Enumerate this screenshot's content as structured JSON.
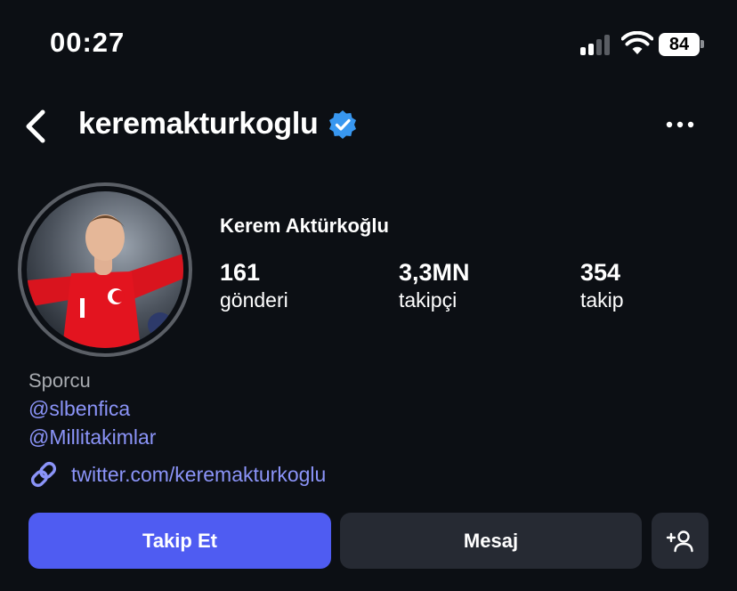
{
  "status_bar": {
    "time": "00:27",
    "battery": "84",
    "signal_bars_active": 2,
    "signal_bars_total": 4
  },
  "header": {
    "username": "keremakturkoglu",
    "back_icon": "chevron-left-icon",
    "verified_icon": "verified-badge-icon",
    "more_icon": "more-horizontal-icon"
  },
  "profile": {
    "display_name": "Kerem Aktürkoğlu",
    "stats": {
      "posts": {
        "count": "161",
        "label": "gönderi"
      },
      "followers": {
        "count": "3,3MN",
        "label": "takipçi"
      },
      "following": {
        "count": "354",
        "label": "takip"
      }
    },
    "bio": {
      "category": "Sporcu",
      "mentions": [
        "@slbenfica",
        "@Millitakimlar"
      ],
      "link": "twitter.com/keremakturkoglu",
      "link_icon": "link-icon"
    }
  },
  "actions": {
    "follow_label": "Takip Et",
    "message_label": "Mesaj",
    "add_user_icon": "add-user-icon"
  },
  "colors": {
    "background": "#0c0f14",
    "accent": "#4f5cf2",
    "link": "#8b94f8",
    "secondary_button": "#262a33",
    "verified": "#3897f0"
  }
}
